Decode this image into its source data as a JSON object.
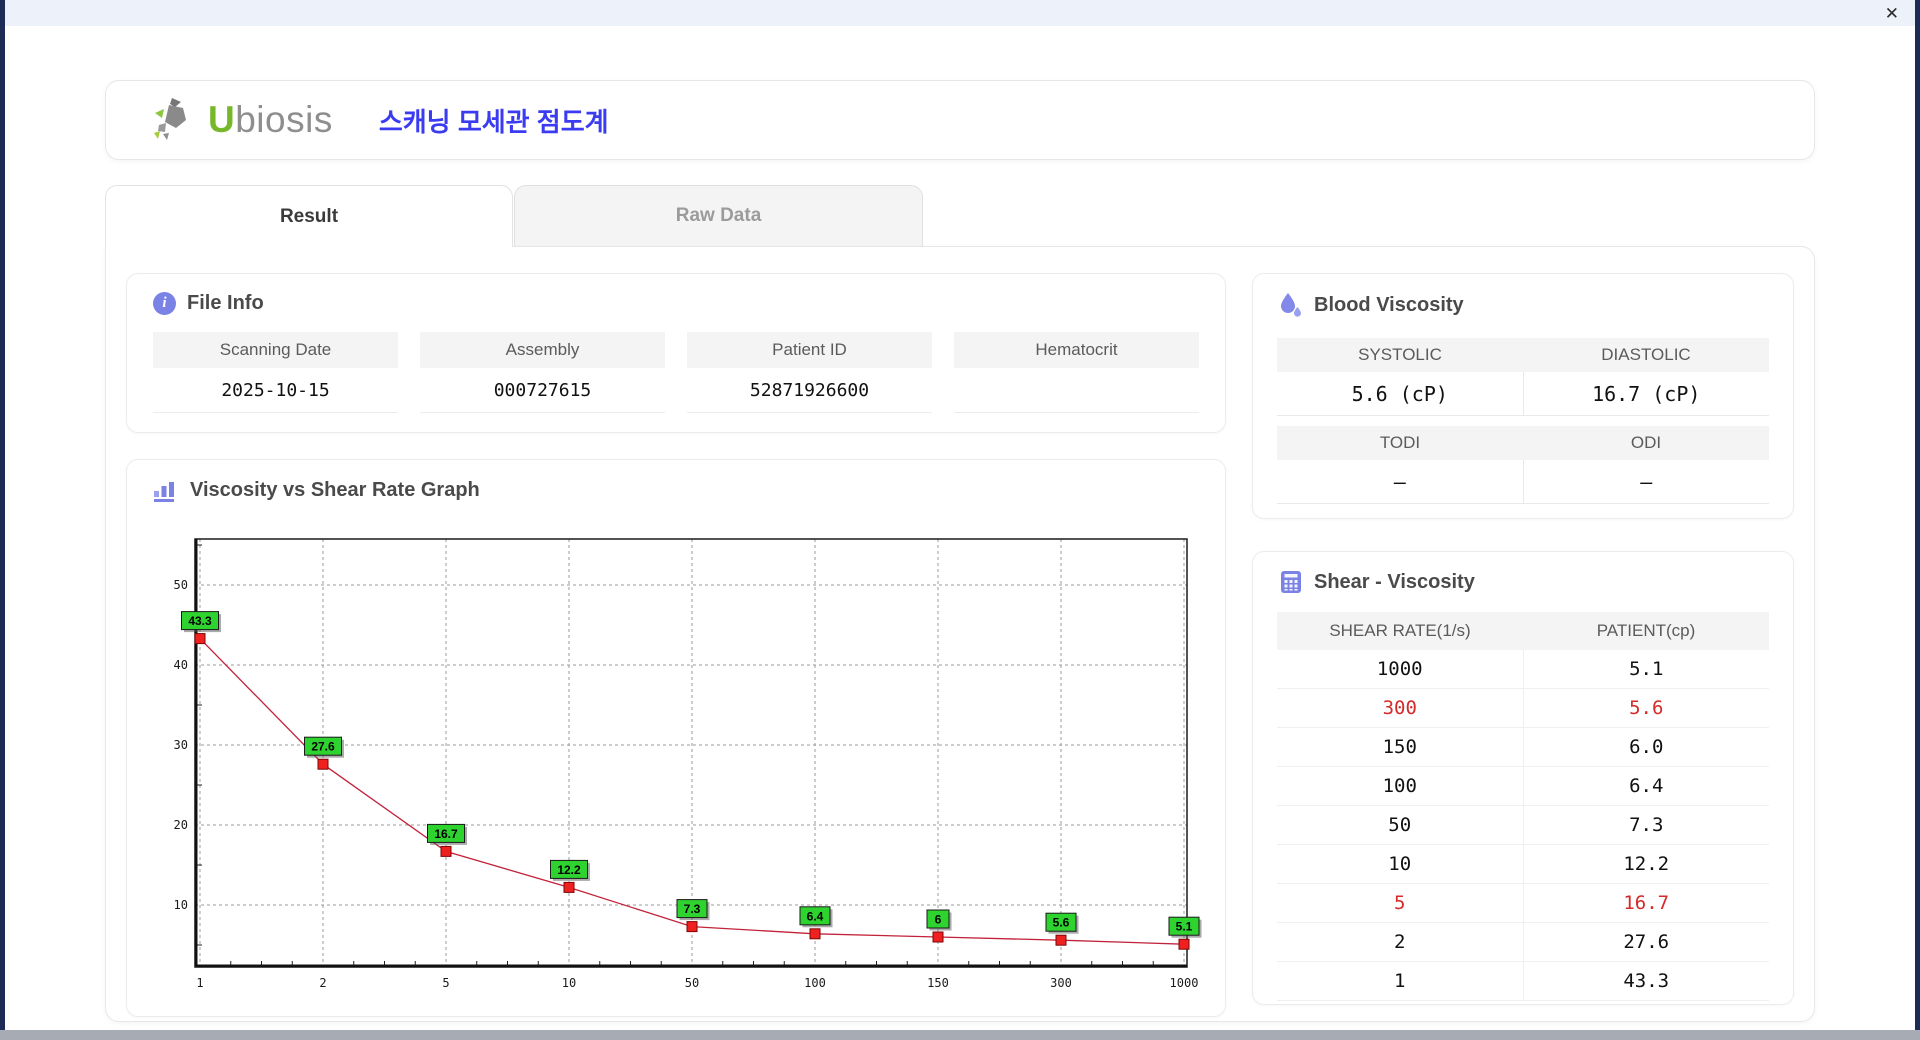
{
  "window": {
    "close_glyph": "✕"
  },
  "header": {
    "logo_u": "U",
    "logo_rest": "biosis",
    "app_title": "스캐닝 모세관 점도계"
  },
  "tabs": [
    {
      "label": "Result",
      "active": true
    },
    {
      "label": "Raw Data",
      "active": false
    }
  ],
  "file_info": {
    "title": "File Info",
    "fields": [
      {
        "label": "Scanning Date",
        "value": "2025-10-15"
      },
      {
        "label": "Assembly",
        "value": "000727615"
      },
      {
        "label": "Patient ID",
        "value": "52871926600"
      },
      {
        "label": "Hematocrit",
        "value": ""
      }
    ]
  },
  "graph": {
    "title": "Viscosity vs Shear Rate Graph"
  },
  "chart_data": {
    "type": "line",
    "title": "Viscosity vs Shear Rate Graph",
    "x": [
      1,
      2,
      5,
      10,
      50,
      100,
      150,
      300,
      1000
    ],
    "x_tick_labels": [
      "1",
      "2",
      "5",
      "10",
      "50",
      "100",
      "150",
      "300",
      "1000"
    ],
    "x_scale": "categorical-log",
    "series": [
      {
        "name": "PATIENT",
        "values": [
          43.3,
          27.6,
          16.7,
          12.2,
          7.3,
          6.4,
          6.0,
          5.6,
          5.1
        ]
      }
    ],
    "point_labels": [
      "43.3",
      "27.6",
      "16.7",
      "12.2",
      "7.3",
      "6.4",
      "6",
      "5.6",
      "5.1"
    ],
    "y_ticks": [
      10,
      20,
      30,
      40,
      50
    ],
    "ylim": [
      2.25,
      55.75
    ],
    "grid": true,
    "legend": "none",
    "line_color": "#c2223a",
    "marker_color": "#ee2020",
    "label_bg": "#2fd32f"
  },
  "blood_viscosity": {
    "title": "Blood Viscosity",
    "groups": [
      {
        "headers": [
          "SYSTOLIC",
          "DIASTOLIC"
        ],
        "values": [
          "5.6 (cP)",
          "16.7 (cP)"
        ]
      },
      {
        "headers": [
          "TODI",
          "ODI"
        ],
        "values": [
          "–",
          "–"
        ]
      }
    ]
  },
  "shear_table": {
    "title": "Shear - Viscosity",
    "columns": [
      "SHEAR RATE(1/s)",
      "PATIENT(cp)"
    ],
    "rows": [
      {
        "shear_rate": "1000",
        "patient": "5.1",
        "highlight": false
      },
      {
        "shear_rate": "300",
        "patient": "5.6",
        "highlight": true
      },
      {
        "shear_rate": "150",
        "patient": "6.0",
        "highlight": false
      },
      {
        "shear_rate": "100",
        "patient": "6.4",
        "highlight": false
      },
      {
        "shear_rate": "50",
        "patient": "7.3",
        "highlight": false
      },
      {
        "shear_rate": "10",
        "patient": "12.2",
        "highlight": false
      },
      {
        "shear_rate": "5",
        "patient": "16.7",
        "highlight": true
      },
      {
        "shear_rate": "2",
        "patient": "27.6",
        "highlight": false
      },
      {
        "shear_rate": "1",
        "patient": "43.3",
        "highlight": false
      }
    ]
  },
  "colors": {
    "accent_purple": "#7b82e6",
    "title_blue": "#3b3bf2",
    "logo_green": "#76b82a",
    "logo_gray": "#8e8e8e",
    "highlight_red": "#d42a2a",
    "navy_edge": "#1d2b57",
    "titlebar_bg": "#edf1f9",
    "header_cell_bg": "#f4f4f5"
  }
}
